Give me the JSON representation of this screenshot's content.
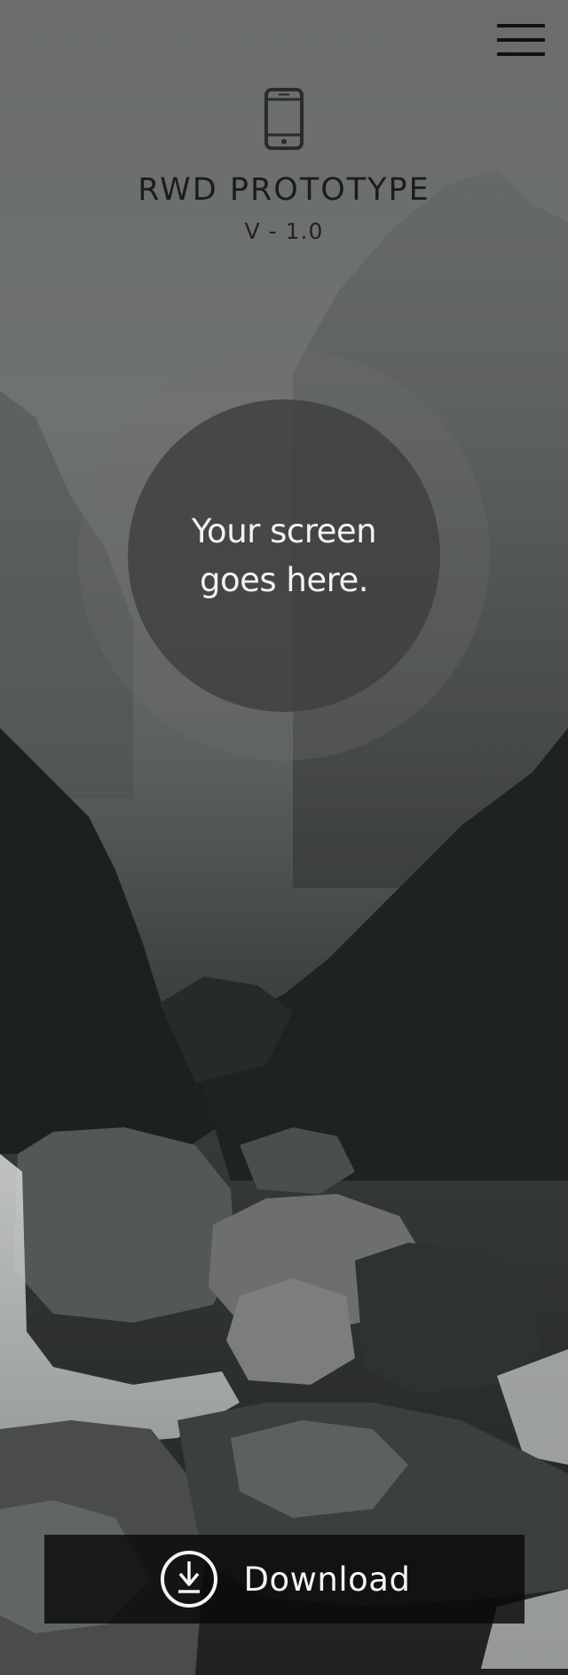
{
  "header": {
    "icon": "smartphone-icon",
    "title": "RWD PROTOTYPE",
    "version": "V - 1.0"
  },
  "menu": {
    "icon": "hamburger-menu-icon"
  },
  "screen_placeholder": {
    "line1": "Your screen",
    "line2": "goes here."
  },
  "download": {
    "icon": "download-circle-icon",
    "label": "Download"
  },
  "colors": {
    "overlay_top": "#6c6e6f",
    "overlay_bottom": "#1a1c1d",
    "button_bg": "#0b0b0b",
    "text_light": "#f4f4f4",
    "text_dark": "#1c1c1c"
  }
}
